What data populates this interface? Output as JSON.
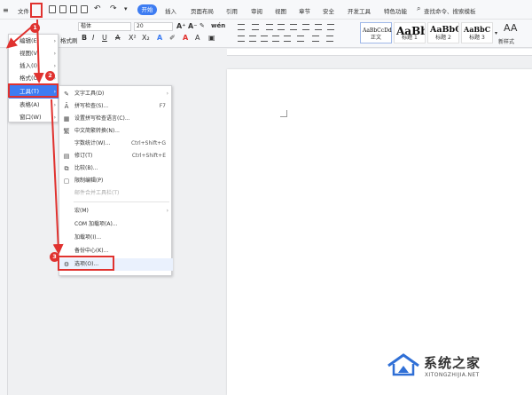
{
  "menubar": {
    "items": [
      "文件",
      "开始",
      "插入",
      "页面布局",
      "引用",
      "审阅",
      "视图",
      "章节",
      "安全",
      "开发工具",
      "特色功能"
    ],
    "search_text": "查找命令、搜索模板"
  },
  "toolbar": {
    "left_label": "格式刷",
    "font_name": "楷体",
    "font_size": "20",
    "styles": [
      {
        "preview": "AaBbCcDd",
        "caption": "正文"
      },
      {
        "preview": "AaBb",
        "caption": "标题 1"
      },
      {
        "preview": "AaBbC",
        "caption": "标题 2"
      },
      {
        "preview": "AaBbC",
        "caption": "标题 3"
      }
    ],
    "new_style_label": "新样式"
  },
  "file_menu": {
    "items": [
      {
        "label": "编辑(E)",
        "has_sub": true
      },
      {
        "label": "视图(V)",
        "has_sub": true
      },
      {
        "label": "插入(I)",
        "has_sub": true
      },
      {
        "label": "格式(O)",
        "has_sub": true
      },
      {
        "label": "工具(T)",
        "has_sub": true,
        "active": true
      },
      {
        "label": "表格(A)",
        "has_sub": true
      },
      {
        "label": "窗口(W)",
        "has_sub": true
      }
    ]
  },
  "tools_menu": {
    "items": [
      {
        "label": "文字工具(D)",
        "shortcut": "",
        "has_sub": true,
        "icon": "text-tool-icon",
        "disabled": false
      },
      {
        "label": "拼写检查(S)...",
        "shortcut": "F7",
        "has_sub": false,
        "icon": "spell-check-icon",
        "disabled": false
      },
      {
        "label": "设置拼写检查语言(C)...",
        "shortcut": "",
        "has_sub": false,
        "icon": "language-icon",
        "disabled": false
      },
      {
        "label": "中文简繁转换(N)...",
        "shortcut": "",
        "has_sub": false,
        "icon": "convert-icon",
        "disabled": false
      },
      {
        "label": "字数统计(W)...",
        "shortcut": "Ctrl+Shift+G",
        "has_sub": false,
        "icon": "",
        "disabled": false
      },
      {
        "label": "修订(T)",
        "shortcut": "Ctrl+Shift+E",
        "has_sub": false,
        "icon": "revision-icon",
        "disabled": false
      },
      {
        "label": "比较(B)...",
        "shortcut": "",
        "has_sub": false,
        "icon": "compare-icon",
        "disabled": false
      },
      {
        "label": "限制编辑(P)",
        "shortcut": "",
        "has_sub": false,
        "icon": "restrict-icon",
        "disabled": false
      },
      {
        "label": "邮件合并工具栏(T)",
        "shortcut": "",
        "has_sub": false,
        "icon": "",
        "disabled": true
      },
      {
        "label": "宏(M)",
        "shortcut": "",
        "has_sub": true,
        "icon": "",
        "disabled": false
      },
      {
        "label": "COM 加载项(A)...",
        "shortcut": "",
        "has_sub": false,
        "icon": "",
        "disabled": false
      },
      {
        "label": "加载项(I)...",
        "shortcut": "",
        "has_sub": false,
        "icon": "",
        "disabled": false
      },
      {
        "label": "备份中心(K)...",
        "shortcut": "",
        "has_sub": false,
        "icon": "",
        "disabled": false
      },
      {
        "label": "选项(O)...",
        "shortcut": "",
        "has_sub": false,
        "icon": "gear-icon",
        "disabled": false,
        "highlight": true
      }
    ]
  },
  "annotations": {
    "badges": [
      "1",
      "2",
      "3"
    ],
    "color": "#e0322f"
  },
  "watermark": {
    "title": "系统之家",
    "url": "XITONGZHIJIA.NET"
  },
  "colors": {
    "accent": "#3d7cf2",
    "annotation": "#e0322f"
  }
}
